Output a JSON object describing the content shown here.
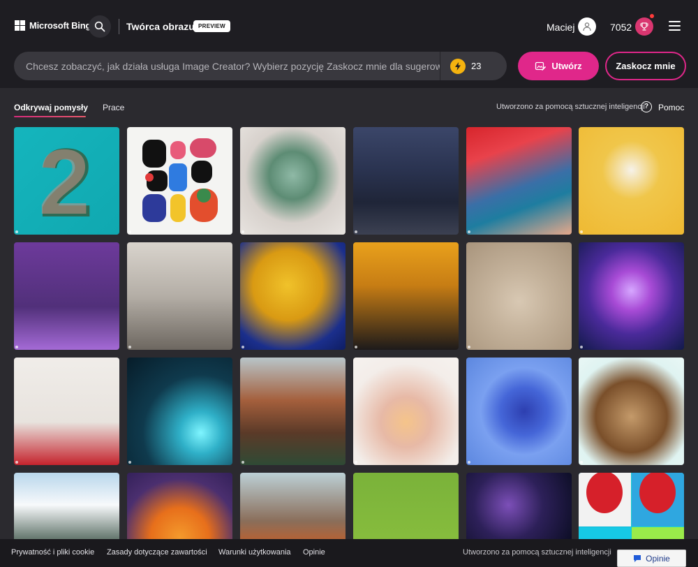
{
  "header": {
    "brand": "Microsoft Bing",
    "app_title": "Twórca obrazu",
    "badge": "PREVIEW",
    "user_name": "Maciej",
    "points": "7052"
  },
  "prompt": {
    "placeholder": "Chcesz zobaczyć, jak działa usługa Image Creator? Wybierz pozycję Zaskocz mnie dla sugerowan",
    "boosts": "23",
    "create_label": "Utwórz",
    "surprise_label": "Zaskocz mnie"
  },
  "tabs": {
    "explore": "Odkrywaj pomysły",
    "works": "Prace"
  },
  "ai_note": "Utworzono za pomocą sztucznej inteligencji",
  "help_label": "Pomoc",
  "colors": {
    "accent": "#e0278a",
    "boost": "#f5b30f",
    "background": "#2b2a2f",
    "header": "#1e1d22"
  },
  "tiles": [
    {
      "name": "teal-number-two",
      "bg": "linear-gradient(135deg,#15b5bd,#10a8b0)",
      "overlay": "two"
    },
    {
      "name": "abstract-shapes",
      "bg": "#f4f4f2",
      "overlay": "shapes"
    },
    {
      "name": "succulent-bouquet",
      "bg": "radial-gradient(circle at 50% 45%,#8fb9a6 0%,#5d8c74 30%,#d7d1cc 60%,#e8e4e0 100%)"
    },
    {
      "name": "dark-castle-landscape",
      "bg": "linear-gradient(180deg,#3b4669 0%,#2a3350 40%,#1f2538 70%,#3c4152 100%)"
    },
    {
      "name": "colorful-eye-makeup",
      "bg": "linear-gradient(160deg,#d7252c 0%,#e9424b 25%,#3a6fa7 55%,#1e7da0 70%,#e7a88a 100%)"
    },
    {
      "name": "shiba-astronaut",
      "bg": "radial-gradient(circle at 50% 40%,#f6f2ea 0%,#f0c64a 35%,#efb932 100%)"
    },
    {
      "name": "purple-robot",
      "bg": "linear-gradient(180deg,#6d3a9b 0%,#51307a 60%,#a46ad6 100%)"
    },
    {
      "name": "futuristic-city",
      "bg": "linear-gradient(180deg,#d9d4cd 0%,#b4aea6 50%,#6d6760 100%)"
    },
    {
      "name": "lemon-hourglass",
      "bg": "radial-gradient(circle at 45% 40%,#f0c22a 0%,#d99a13 40%,#1b2f8c 75%,#0e1d62 100%)"
    },
    {
      "name": "elephant-tuxedo",
      "bg": "linear-gradient(180deg,#e9a11c 0%,#c77d14 40%,#1d1a1a 100%)"
    },
    {
      "name": "gold-ring",
      "bg": "radial-gradient(circle at 50% 55%,#d8c8b3 0%,#c4b29b 40%,#a8947c 100%)"
    },
    {
      "name": "cosmic-figure",
      "bg": "radial-gradient(circle at 50% 45%,#d6a7ff 0%,#a84bd6 25%,#4a2a9a 55%,#121a4a 100%)"
    },
    {
      "name": "red-room",
      "bg": "linear-gradient(180deg,#f0ede9 0%,#e8e3de 60%,#c5232d 100%)"
    },
    {
      "name": "hamster-crystal-ball",
      "bg": "radial-gradient(circle at 70% 70%,#7ff5ff 0%,#2fb0c8 20%,#0f3a4d 55%,#071c29 100%)"
    },
    {
      "name": "castle-ruins-painting",
      "bg": "linear-gradient(180deg,#b8c5c9 0%,#a45f3c 40%,#5b3a28 70%,#2f4a35 100%)"
    },
    {
      "name": "lavender-cocktail",
      "bg": "radial-gradient(circle at 50% 60%,#f5c48a 0%,#e7b9a6 30%,#f3ede9 70%,#f6f2ef 100%)"
    },
    {
      "name": "blue-dahlia",
      "bg": "radial-gradient(circle at 55% 50%,#2d3fb0 0%,#4566d8 30%,#7aa0f0 55%,#5c87df 100%)"
    },
    {
      "name": "coconut-island",
      "bg": "radial-gradient(circle at 50% 55%,#c49a6a 0%,#7a4f2a 45%,#dff3f1 75%,#e9f7f5 100%)"
    },
    {
      "name": "forest-cabin",
      "bg": "linear-gradient(180deg,#b9d7ec 0%,#f7f9fb 30%,#6b7d74 60%,#2e3a35 100%)"
    },
    {
      "name": "pancake-stack",
      "bg": "radial-gradient(circle at 50% 60%,#f49a2c 0%,#e76f1b 35%,#4b2f6f 70%,#34215a 100%)"
    },
    {
      "name": "volcano-eruption",
      "bg": "linear-gradient(180deg,#bcd0d6 0%,#8a6e5a 45%,#d25a1c 75%,#2c2724 100%)"
    },
    {
      "name": "flower-guitar",
      "bg": "linear-gradient(180deg,#7ab23a 0%,#86bc3d 60%,#6d9e2e 100%)"
    },
    {
      "name": "astronaut-space",
      "bg": "radial-gradient(circle at 40% 30%,#7c4fb8 0%,#2d2059 35%,#0b0d23 75%)"
    },
    {
      "name": "strawberry-pop-art",
      "bg": "linear-gradient(90deg,#0eb9d8 0%,#0eb9d8 48%,#1ed9c9 52%,#1ed9c9 100%)",
      "overlay": "strawberry"
    }
  ],
  "footer": {
    "privacy": "Prywatność i pliki cookie",
    "content_policy": "Zasady dotyczące zawartości",
    "terms": "Warunki użytkowania",
    "feedback_link": "Opinie",
    "ai_note": "Utworzono za pomocą sztucznej inteligencji",
    "feedback_button": "Opinie"
  }
}
